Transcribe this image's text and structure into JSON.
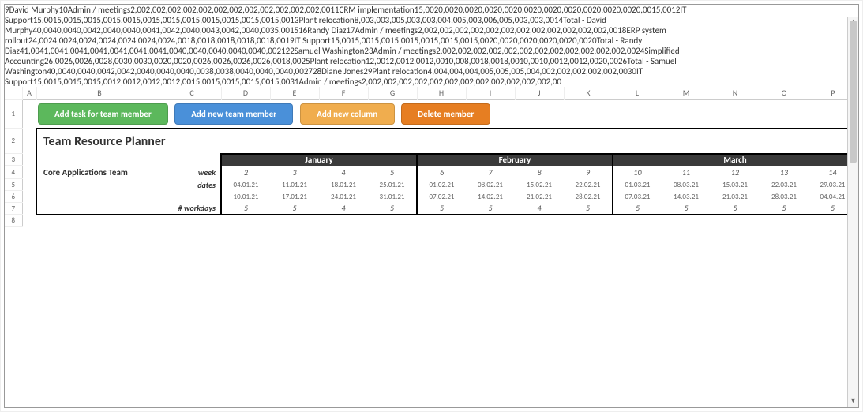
{
  "columns": [
    "A",
    "B",
    "C",
    "D",
    "E",
    "F",
    "G",
    "H",
    "I",
    "J",
    "K",
    "L",
    "M",
    "N",
    "O",
    "P"
  ],
  "buttons": {
    "add_task": "Add task for team member",
    "add_member": "Add new team member",
    "add_column": "Add new column",
    "delete_member": "Delete member"
  },
  "header": {
    "title": "Team Resource Planner",
    "subtitle": "Core Applications Team",
    "week_lbl": "week",
    "dates_lbl": "dates",
    "workdays_lbl": "# workdays"
  },
  "months": [
    "January",
    "February",
    "March"
  ],
  "weeks": [
    "2",
    "3",
    "4",
    "5",
    "6",
    "7",
    "8",
    "9",
    "10",
    "11",
    "12",
    "13",
    "14"
  ],
  "dates1": [
    "04.01.21",
    "11.01.21",
    "18.01.21",
    "25.01.21",
    "01.02.21",
    "08.02.21",
    "15.02.21",
    "22.02.21",
    "01.03.21",
    "08.03.21",
    "15.03.21",
    "22.03.21",
    "29.03.21"
  ],
  "dates2": [
    "10.01.21",
    "17.01.21",
    "24.01.21",
    "31.01.21",
    "07.02.21",
    "14.02.21",
    "21.02.21",
    "28.02.21",
    "07.03.21",
    "14.03.21",
    "21.03.21",
    "28.03.21",
    "04.04.21"
  ],
  "workdays": [
    "5",
    "5",
    "4",
    "5",
    "5",
    "5",
    "4",
    "5",
    "5",
    "5",
    "5",
    "5",
    "5"
  ],
  "members": [
    {
      "name": "David Murphy",
      "tasks": [
        {
          "name": "Admin / meetings",
          "v": [
            "2,00",
            "2,00",
            "2,00",
            "2,00",
            "2,00",
            "2,00",
            "2,00",
            "2,00",
            "2,00",
            "2,00",
            "2,00",
            "2,00",
            "2,00"
          ]
        },
        {
          "name": "CRM  implementation",
          "v": [
            "15,00",
            "20,00",
            "20,00",
            "20,00",
            "20,00",
            "20,00",
            "20,00",
            "20,00",
            "20,00",
            "20,00",
            "20,00",
            "20,00",
            "15,00"
          ]
        },
        {
          "name": "IT Support",
          "v": [
            "15,00",
            "15,00",
            "15,00",
            "15,00",
            "15,00",
            "15,00",
            "15,00",
            "15,00",
            "15,00",
            "15,00",
            "15,00",
            "15,00",
            "15,00"
          ]
        },
        {
          "name": "Plant relocation",
          "v": [
            "8,00",
            "3,00",
            "3,00",
            "5,00",
            "3,00",
            "3,00",
            "4,00",
            "5,00",
            "3,00",
            "6,00",
            "5,00",
            "3,00",
            "3,00"
          ]
        }
      ],
      "total_lbl": "Total - David Murphy",
      "total": [
        "40,00",
        "40,00",
        "40,00",
        "42,00",
        "40,00",
        "40,00",
        "41,00",
        "42,00",
        "40,00",
        "43,00",
        "42,00",
        "40,00",
        "35,00"
      ]
    },
    {
      "name": "Randy Diaz",
      "tasks": [
        {
          "name": "Admin / meetings",
          "v": [
            "2,00",
            "2,00",
            "2,00",
            "2,00",
            "2,00",
            "2,00",
            "2,00",
            "2,00",
            "2,00",
            "2,00",
            "2,00",
            "2,00",
            "2,00"
          ]
        },
        {
          "name": "ERP system rollout",
          "v": [
            "24,00",
            "24,00",
            "24,00",
            "24,00",
            "24,00",
            "24,00",
            "24,00",
            "24,00",
            "18,00",
            "18,00",
            "18,00",
            "18,00",
            "18,00"
          ]
        },
        {
          "name": "IT Support",
          "v": [
            "15,00",
            "15,00",
            "15,00",
            "15,00",
            "15,00",
            "15,00",
            "15,00",
            "15,00",
            "20,00",
            "20,00",
            "20,00",
            "20,00",
            "20,00"
          ]
        }
      ],
      "total_lbl": "Total - Randy Diaz",
      "total": [
        "41,00",
        "41,00",
        "41,00",
        "41,00",
        "41,00",
        "41,00",
        "41,00",
        "41,00",
        "40,00",
        "40,00",
        "40,00",
        "40,00",
        "40,00"
      ]
    },
    {
      "name": "Samuel Washington",
      "tasks": [
        {
          "name": "Admin / meetings",
          "v": [
            "2,00",
            "2,00",
            "2,00",
            "2,00",
            "2,00",
            "2,00",
            "2,00",
            "2,00",
            "2,00",
            "2,00",
            "2,00",
            "2,00",
            "2,00"
          ]
        },
        {
          "name": "Simplified Accounting",
          "v": [
            "26,00",
            "26,00",
            "26,00",
            "28,00",
            "30,00",
            "30,00",
            "20,00",
            "20,00",
            "26,00",
            "26,00",
            "26,00",
            "26,00",
            "18,00"
          ]
        },
        {
          "name": "Plant relocation",
          "v": [
            "12,00",
            "12,00",
            "12,00",
            "12,00",
            "10,00",
            "8,00",
            "18,00",
            "18,00",
            "10,00",
            "10,00",
            "12,00",
            "12,00",
            "20,00"
          ]
        }
      ],
      "total_lbl": "Total - Samuel Washington",
      "total": [
        "40,00",
        "40,00",
        "40,00",
        "42,00",
        "42,00",
        "40,00",
        "40,00",
        "40,00",
        "38,00",
        "38,00",
        "40,00",
        "40,00",
        "40,00"
      ]
    },
    {
      "name": "Diane Jones",
      "tasks": [
        {
          "name": "Plant relocation",
          "v": [
            "4,00",
            "4,00",
            "4,00",
            "4,00",
            "5,00",
            "5,00",
            "5,00",
            "4,00",
            "2,00",
            "2,00",
            "2,00",
            "2,00",
            "2,00"
          ]
        },
        {
          "name": "IT Support",
          "v": [
            "15,00",
            "15,00",
            "15,00",
            "15,00",
            "12,00",
            "12,00",
            "12,00",
            "12,00",
            "15,00",
            "15,00",
            "15,00",
            "15,00",
            "15,00"
          ]
        },
        {
          "name": "Admin / meetings",
          "v": [
            "2,00",
            "2,00",
            "2,00",
            "2,00",
            "2,00",
            "2,00",
            "2,00",
            "2,00",
            "2,00",
            "2,00",
            "2,00",
            "2,00",
            "2,00"
          ]
        }
      ],
      "total_lbl": "",
      "total": []
    }
  ],
  "chart_data": {
    "type": "table",
    "title": "Team Resource Planner — Core Applications Team",
    "columns_weeks": [
      2,
      3,
      4,
      5,
      6,
      7,
      8,
      9,
      10,
      11,
      12,
      13,
      14
    ],
    "series": [
      {
        "name": "David Murphy / Admin meetings",
        "values": [
          2,
          2,
          2,
          2,
          2,
          2,
          2,
          2,
          2,
          2,
          2,
          2,
          2
        ]
      },
      {
        "name": "David Murphy / CRM implementation",
        "values": [
          15,
          20,
          20,
          20,
          20,
          20,
          20,
          20,
          20,
          20,
          20,
          20,
          15
        ]
      },
      {
        "name": "David Murphy / IT Support",
        "values": [
          15,
          15,
          15,
          15,
          15,
          15,
          15,
          15,
          15,
          15,
          15,
          15,
          15
        ]
      },
      {
        "name": "David Murphy / Plant relocation",
        "values": [
          8,
          3,
          3,
          5,
          3,
          3,
          4,
          5,
          3,
          6,
          5,
          3,
          3
        ]
      },
      {
        "name": "David Murphy / Total",
        "values": [
          40,
          40,
          40,
          42,
          40,
          40,
          41,
          42,
          40,
          43,
          42,
          40,
          35
        ]
      },
      {
        "name": "Randy Diaz / Admin meetings",
        "values": [
          2,
          2,
          2,
          2,
          2,
          2,
          2,
          2,
          2,
          2,
          2,
          2,
          2
        ]
      },
      {
        "name": "Randy Diaz / ERP system rollout",
        "values": [
          24,
          24,
          24,
          24,
          24,
          24,
          24,
          24,
          18,
          18,
          18,
          18,
          18
        ]
      },
      {
        "name": "Randy Diaz / IT Support",
        "values": [
          15,
          15,
          15,
          15,
          15,
          15,
          15,
          15,
          20,
          20,
          20,
          20,
          20
        ]
      },
      {
        "name": "Randy Diaz / Total",
        "values": [
          41,
          41,
          41,
          41,
          41,
          41,
          41,
          41,
          40,
          40,
          40,
          40,
          40
        ]
      },
      {
        "name": "Samuel Washington / Admin meetings",
        "values": [
          2,
          2,
          2,
          2,
          2,
          2,
          2,
          2,
          2,
          2,
          2,
          2,
          2
        ]
      },
      {
        "name": "Samuel Washington / Simplified Accounting",
        "values": [
          26,
          26,
          26,
          28,
          30,
          30,
          20,
          20,
          26,
          26,
          26,
          26,
          18
        ]
      },
      {
        "name": "Samuel Washington / Plant relocation",
        "values": [
          12,
          12,
          12,
          12,
          10,
          8,
          18,
          18,
          10,
          10,
          12,
          12,
          20
        ]
      },
      {
        "name": "Samuel Washington / Total",
        "values": [
          40,
          40,
          40,
          42,
          42,
          40,
          40,
          40,
          38,
          38,
          40,
          40,
          40
        ]
      },
      {
        "name": "Diane Jones / Plant relocation",
        "values": [
          4,
          4,
          4,
          4,
          5,
          5,
          5,
          4,
          2,
          2,
          2,
          2,
          2
        ]
      },
      {
        "name": "Diane Jones / IT Support",
        "values": [
          15,
          15,
          15,
          15,
          12,
          12,
          12,
          12,
          15,
          15,
          15,
          15,
          15
        ]
      },
      {
        "name": "Diane Jones / Admin meetings",
        "values": [
          2,
          2,
          2,
          2,
          2,
          2,
          2,
          2,
          2,
          2,
          2,
          2,
          2
        ]
      }
    ]
  }
}
